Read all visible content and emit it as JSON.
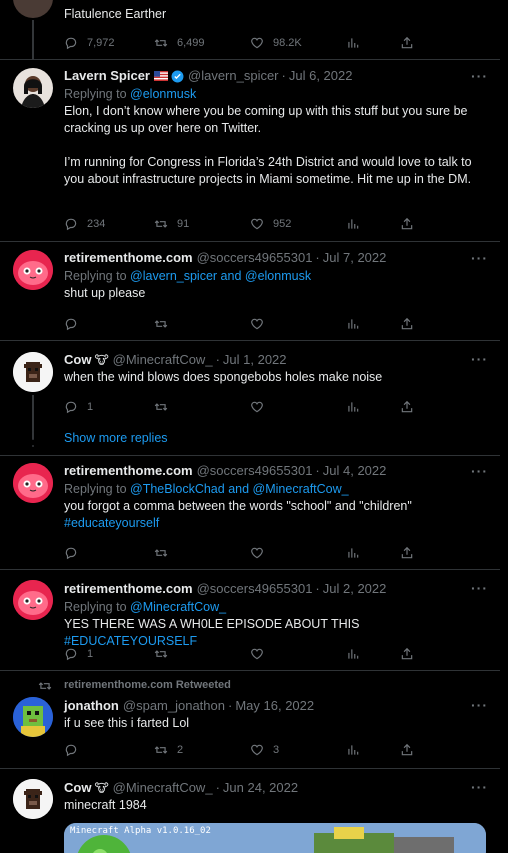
{
  "top": {
    "text": "Flatulence Earther",
    "replies": "7,972",
    "retweets": "6,499",
    "likes": "98.2K"
  },
  "tweets": [
    {
      "name": "Lavern Spicer",
      "handle": "@lavern_spicer",
      "date": "Jul 6, 2022",
      "reply_prefix": "Replying to",
      "reply_to": "@elonmusk",
      "text1": "Elon, I don’t know where you be coming up with this stuff but you sure be cracking us up over here on Twitter.",
      "text2": "I’m running for Congress in Florida’s 24th District and would love to talk to you about infrastructure projects in Miami sometime. Hit me up in the DM.",
      "replies": "234",
      "retweets": "91",
      "likes": "952"
    },
    {
      "name": "retirementhome.com",
      "handle": "@soccers49655301",
      "date": "Jul 7, 2022",
      "reply_prefix": "Replying to",
      "reply_to_1": "@lavern_spicer",
      "reply_and": "and",
      "reply_to_2": "@elonmusk",
      "text": "shut up please"
    },
    {
      "name": "Cow",
      "emoji": "🐮",
      "handle": "@MinecraftCow_",
      "date": "Jul 1, 2022",
      "text": "when the wind blows does spongebobs holes make noise",
      "replies": "1"
    },
    {
      "name": "retirementhome.com",
      "handle": "@soccers49655301",
      "date": "Jul 4, 2022",
      "reply_prefix": "Replying to",
      "reply_to_1": "@TheBlockChad",
      "reply_and": "and",
      "reply_to_2": "@MinecraftCow_",
      "text": "you forgot a comma between the words \"school\" and \"children\"",
      "hashtag": "#educateyourself"
    },
    {
      "name": "retirementhome.com",
      "handle": "@soccers49655301",
      "date": "Jul 2, 2022",
      "reply_prefix": "Replying to",
      "reply_to": "@MinecraftCow_",
      "text": "YES THERE WAS A WH0LE EPISODE ABOUT THIS",
      "hashtag": "#EDUCATEYOURSELF",
      "replies": "1"
    },
    {
      "retweeted_by": "retirementhome.com Retweeted",
      "name": "jonathon",
      "handle": "@spam_jonathon",
      "date": "May 16, 2022",
      "text": "if u see this  i farted Lol",
      "retweets": "2",
      "likes": "3"
    },
    {
      "name": "Cow",
      "emoji": "🐮",
      "handle": "@MinecraftCow_",
      "date": "Jun 24, 2022",
      "text": "minecraft 1984",
      "media_caption": "Minecraft Alpha v1.0.16_02"
    }
  ],
  "show_more": "Show more replies",
  "dot": "·",
  "more_glyph": "···",
  "colors": {
    "bg": "#000000",
    "text": "#e7e9ea",
    "muted": "#71767b",
    "link": "#1d9bf0",
    "border": "#2f3336"
  }
}
